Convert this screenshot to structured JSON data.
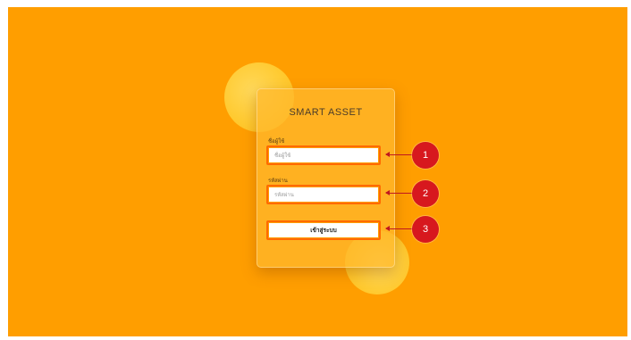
{
  "app": {
    "title": "SMART ASSET"
  },
  "login": {
    "username_label": "ชื่อผู้ใช้",
    "username_placeholder": "ชื่อผู้ใช้",
    "password_label": "รหัสผ่าน",
    "password_placeholder": "รหัสผ่าน",
    "submit_label": "เข้าสู่ระบบ"
  },
  "callouts": [
    {
      "number": "1"
    },
    {
      "number": "2"
    },
    {
      "number": "3"
    }
  ],
  "colors": {
    "background": "#ff9e00",
    "field_border": "#ff6a00",
    "callout": "#d7181e"
  }
}
